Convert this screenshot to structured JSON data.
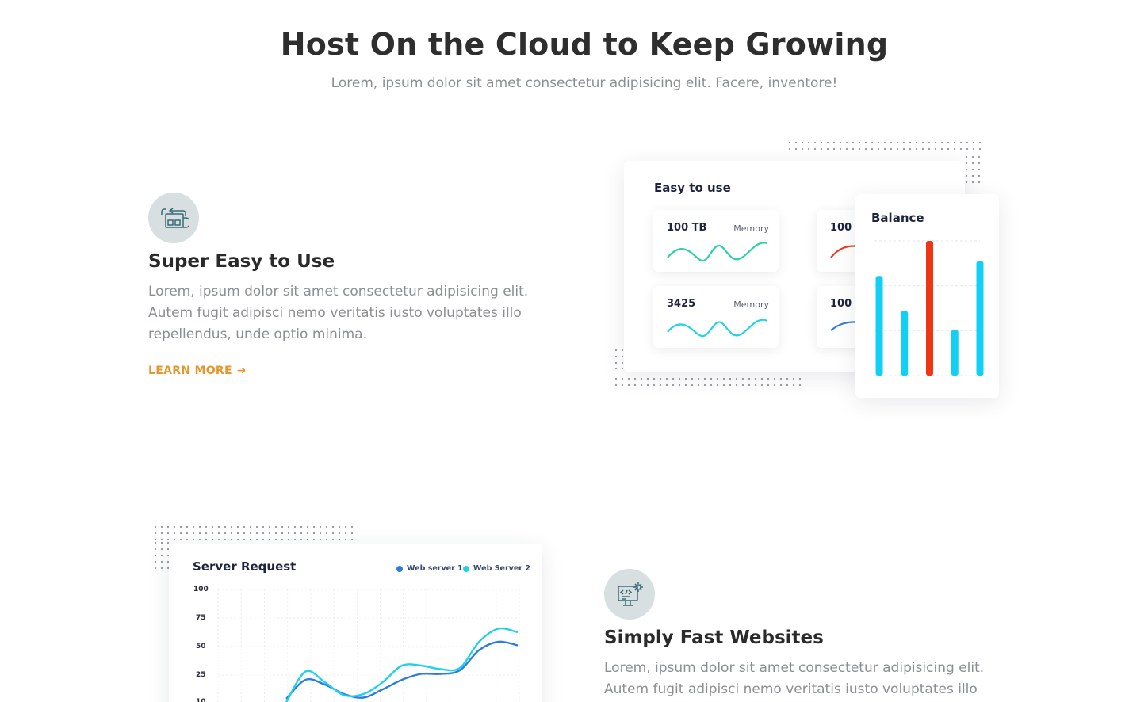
{
  "header": {
    "title": "Host On the Cloud to Keep Growing",
    "subtitle": "Lorem, ipsum dolor sit amet consectetur adipisicing elit. Facere, inventore!"
  },
  "features": [
    {
      "icon": "migrate-box-icon",
      "title": "Super Easy to Use",
      "text": "Lorem, ipsum dolor sit amet consectetur adipisicing elit. Autem fugit adipisci nemo veritatis iusto voluptates illo repellendus, unde optio minima.",
      "link": "LEARN MORE",
      "link_arrow": "➜"
    },
    {
      "icon": "code-gear-monitor-icon",
      "title": "Simply Fast Websites",
      "text": "Lorem, ipsum dolor sit amet consectetur adipisicing elit. Autem fugit adipisci nemo veritatis iusto voluptates illo repellendus,"
    }
  ],
  "dashboard": {
    "title": "Easy to use",
    "tiles": [
      {
        "value": "100 TB",
        "label": "Memory",
        "color": "#2fd0a6"
      },
      {
        "value": "3425",
        "label": "Memory",
        "color": "#22d3e6"
      },
      {
        "value": "100 T",
        "label": "",
        "color": "#ee3b21"
      },
      {
        "value": "100 T",
        "label": "",
        "color": "#2e7de0"
      }
    ]
  },
  "balance": {
    "title": "Balance",
    "bars": [
      0.74,
      0.48,
      1.0,
      0.34,
      0.85
    ],
    "highlight_index": 2,
    "bar_color": "#12d0f3",
    "highlight_color": "#f03515"
  },
  "server_request": {
    "title": "Server Request",
    "legend": [
      {
        "name": "Web server 1",
        "color": "#2a7de1"
      },
      {
        "name": "Web Server 2",
        "color": "#1fd2e9"
      }
    ],
    "yticks": [
      "100",
      "75",
      "50",
      "25",
      "10"
    ]
  },
  "chart_data": {
    "type": "line",
    "title": "Server Request",
    "ylim": [
      0,
      100
    ],
    "x": [
      0,
      1,
      2,
      3,
      4,
      5,
      6,
      7,
      8,
      9,
      10,
      11,
      12
    ],
    "series": [
      {
        "name": "Web server 1",
        "values": [
          8,
          24,
          20,
          12,
          9,
          16,
          24,
          29,
          29,
          32,
          49,
          56,
          53
        ]
      },
      {
        "name": "Web Server 2",
        "values": [
          5,
          31,
          22,
          11,
          12,
          22,
          36,
          36,
          33,
          34,
          56,
          67,
          64
        ]
      }
    ]
  }
}
